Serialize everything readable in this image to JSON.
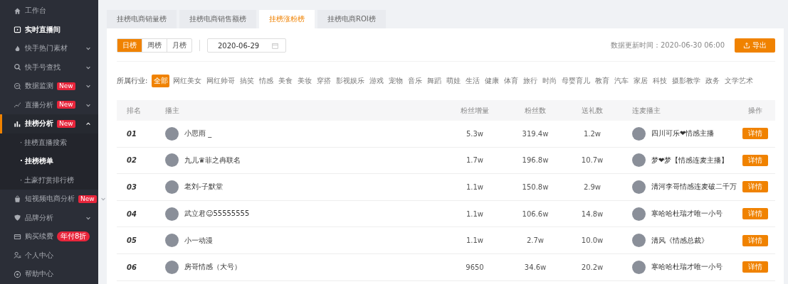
{
  "sidebar": {
    "items": [
      {
        "label": "工作台",
        "highlighted": false,
        "selected": false
      },
      {
        "label": "实时直播间",
        "highlighted": true,
        "selected": false
      },
      {
        "label": "快手热门素材",
        "highlighted": false,
        "selected": false,
        "expanded": false
      },
      {
        "label": "快手号查找",
        "highlighted": false,
        "selected": false,
        "expanded": false
      },
      {
        "label": "数据监测",
        "highlighted": false,
        "selected": false,
        "expanded": false,
        "badge": {
          "kind": "new",
          "text": "New"
        }
      },
      {
        "label": "直播分析",
        "highlighted": false,
        "selected": false,
        "expanded": false,
        "badge": {
          "kind": "new",
          "text": "New"
        }
      },
      {
        "label": "挂榜分析",
        "highlighted": true,
        "selected": true,
        "expanded": true,
        "badge": {
          "kind": "new",
          "text": "New"
        },
        "children": [
          {
            "label": "· 挂榜直播搜索",
            "selected": false
          },
          {
            "label": "· 挂榜榜单",
            "selected": true
          },
          {
            "label": "· 土豪打赏排行榜",
            "selected": false
          }
        ]
      },
      {
        "label": "短视频电商分析",
        "highlighted": false,
        "selected": false,
        "expanded": false,
        "badge": {
          "kind": "new",
          "text": "New"
        }
      },
      {
        "label": "品牌分析",
        "highlighted": false,
        "selected": false,
        "expanded": false
      },
      {
        "label": "购买续费",
        "highlighted": false,
        "selected": false,
        "badge": {
          "kind": "promo",
          "text": "年付8折"
        }
      },
      {
        "label": "个人中心",
        "highlighted": false,
        "selected": false
      },
      {
        "label": "帮助中心",
        "highlighted": false,
        "selected": false
      }
    ]
  },
  "tabs": [
    {
      "label": "挂榜电商销量榜",
      "selected": false
    },
    {
      "label": "挂榜电商销售额榜",
      "selected": false
    },
    {
      "label": "挂榜涨粉榜",
      "selected": true
    },
    {
      "label": "挂榜电商ROI榜",
      "selected": false
    }
  ],
  "periods": [
    {
      "label": "日榜",
      "selected": true
    },
    {
      "label": "周榜",
      "selected": false
    },
    {
      "label": "月榜",
      "selected": false
    }
  ],
  "date_field": {
    "value": "2020-06-29"
  },
  "update_time": "数据更新时间：2020-06-30 06:00",
  "export_button": "导出",
  "industry": {
    "label": "所属行业:",
    "options": [
      {
        "label": "全部",
        "selected": true
      },
      {
        "label": "网红美女",
        "selected": false
      },
      {
        "label": "网红帅哥",
        "selected": false
      },
      {
        "label": "搞笑",
        "selected": false
      },
      {
        "label": "情感",
        "selected": false
      },
      {
        "label": "美食",
        "selected": false
      },
      {
        "label": "美妆",
        "selected": false
      },
      {
        "label": "穿搭",
        "selected": false
      },
      {
        "label": "影视娱乐",
        "selected": false
      },
      {
        "label": "游戏",
        "selected": false
      },
      {
        "label": "宠物",
        "selected": false
      },
      {
        "label": "音乐",
        "selected": false
      },
      {
        "label": "舞蹈",
        "selected": false
      },
      {
        "label": "萌娃",
        "selected": false
      },
      {
        "label": "生活",
        "selected": false
      },
      {
        "label": "健康",
        "selected": false
      },
      {
        "label": "体育",
        "selected": false
      },
      {
        "label": "旅行",
        "selected": false
      },
      {
        "label": "时尚",
        "selected": false
      },
      {
        "label": "母婴育儿",
        "selected": false
      },
      {
        "label": "教育",
        "selected": false
      },
      {
        "label": "汽车",
        "selected": false
      },
      {
        "label": "家居",
        "selected": false
      },
      {
        "label": "科技",
        "selected": false
      },
      {
        "label": "摄影教学",
        "selected": false
      },
      {
        "label": "政务",
        "selected": false
      },
      {
        "label": "文学艺术",
        "selected": false
      }
    ]
  },
  "table": {
    "columns": [
      "排名",
      "播主",
      "粉丝增量",
      "粉丝数",
      "送礼数",
      "连麦播主",
      "操作"
    ],
    "rows": [
      {
        "rank": "01",
        "anchor": "小思雨 _",
        "fan_gain": "5.3w",
        "fans": "319.4w",
        "gifts": "1.2w",
        "co_host": "四川可乐❤情感主播",
        "action": "详情"
      },
      {
        "rank": "02",
        "anchor": "九儿♛菲之冉联名",
        "fan_gain": "1.7w",
        "fans": "196.8w",
        "gifts": "10.7w",
        "co_host": "梦❤梦【情感连麦主播】",
        "action": "详情"
      },
      {
        "rank": "03",
        "anchor": "老刘-子默堂",
        "fan_gain": "1.1w",
        "fans": "150.8w",
        "gifts": "2.9w",
        "co_host": "清河李哥情感连麦破二千万",
        "action": "详情"
      },
      {
        "rank": "04",
        "anchor": "武立君☺55555555",
        "fan_gain": "1.1w",
        "fans": "106.6w",
        "gifts": "14.8w",
        "co_host": "寒哈哈杜瑞才唯一小号",
        "action": "详情"
      },
      {
        "rank": "05",
        "anchor": "小一动漫",
        "fan_gain": "1.1w",
        "fans": "2.7w",
        "gifts": "10.0w",
        "co_host": "清风《情感总裁》",
        "action": "详情"
      },
      {
        "rank": "06",
        "anchor": "房哥情感（大号）",
        "fan_gain": "9650",
        "fans": "34.6w",
        "gifts": "20.2w",
        "co_host": "寒哈哈杜瑞才唯一小号",
        "action": "详情"
      }
    ]
  }
}
